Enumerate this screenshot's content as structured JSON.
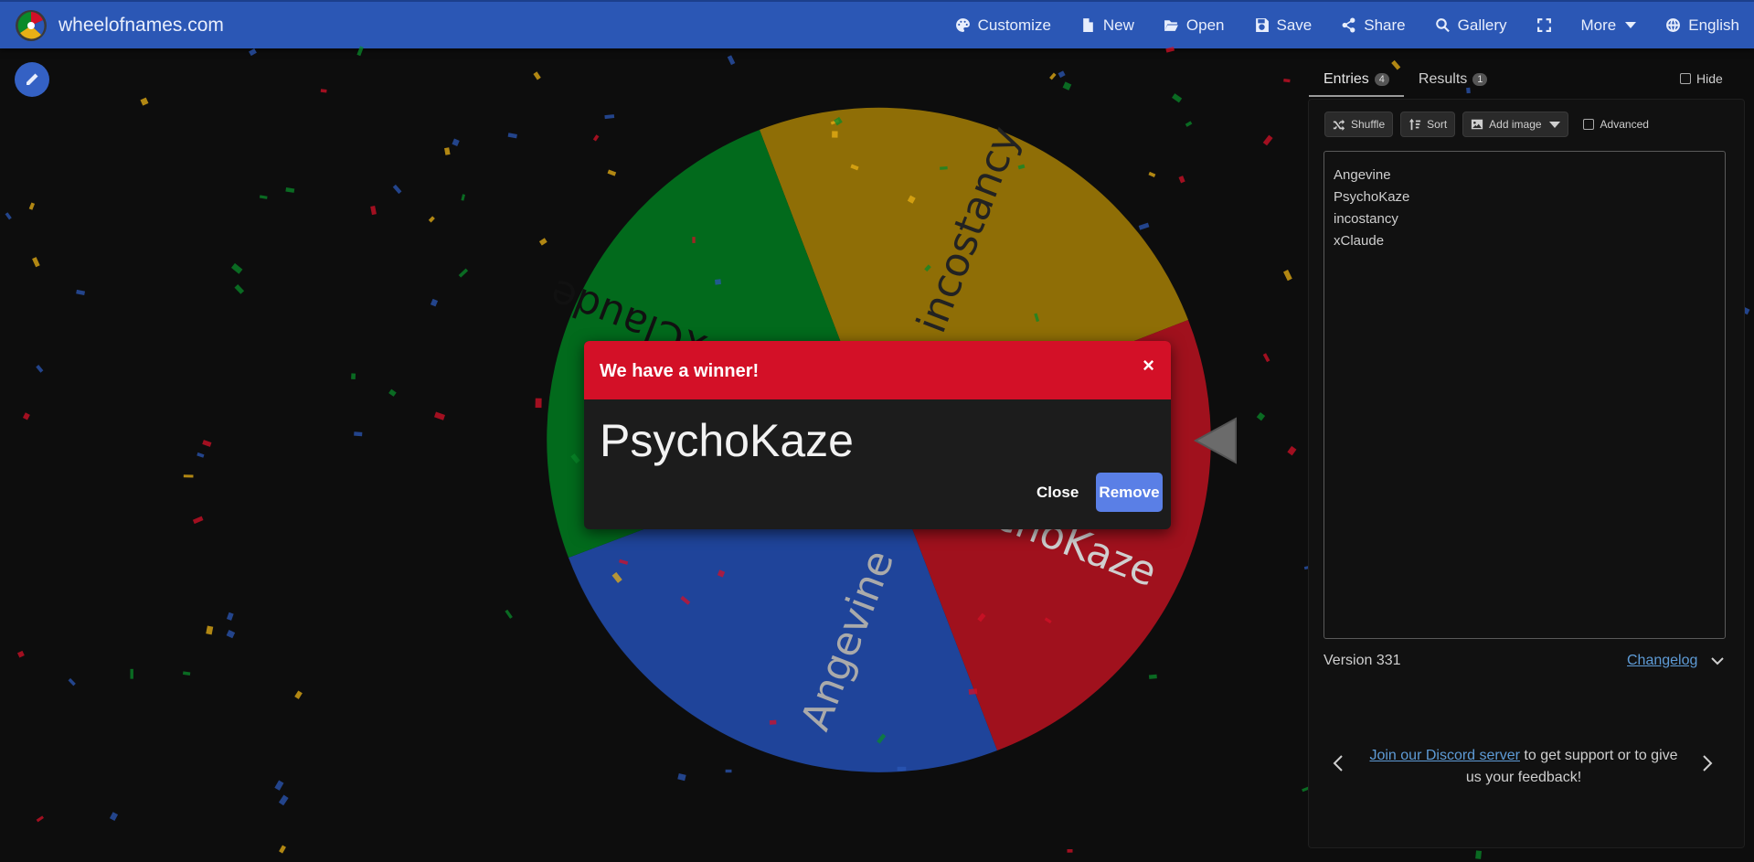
{
  "header": {
    "site_title": "wheelofnames.com",
    "menu": [
      {
        "label": "Customize",
        "icon": "palette-icon"
      },
      {
        "label": "New",
        "icon": "file-icon"
      },
      {
        "label": "Open",
        "icon": "folder-open-icon"
      },
      {
        "label": "Save",
        "icon": "save-icon"
      },
      {
        "label": "Share",
        "icon": "share-icon"
      },
      {
        "label": "Gallery",
        "icon": "search-icon"
      },
      {
        "label": "",
        "icon": "fullscreen-icon"
      },
      {
        "label": "More",
        "icon": "caret-down-icon"
      },
      {
        "label": "English",
        "icon": "globe-icon"
      }
    ]
  },
  "wheel": {
    "segments": [
      {
        "label": "incostancy",
        "color": "#8f6e06"
      },
      {
        "label": "PsychoKaze",
        "color": "#a0111d"
      },
      {
        "label": "Angevine",
        "color": "#1f449a"
      },
      {
        "label": "xClaude",
        "color": "#026a1c"
      }
    ]
  },
  "dialog": {
    "title": "We have a winner!",
    "close_x": "×",
    "winner": "PsychoKaze",
    "close_label": "Close",
    "remove_label": "Remove"
  },
  "sidebar": {
    "tabs": [
      {
        "label": "Entries",
        "count": "4"
      },
      {
        "label": "Results",
        "count": "1"
      }
    ],
    "hide_label": "Hide",
    "toolbar": {
      "shuffle": "Shuffle",
      "sort": "Sort",
      "add_image": "Add image",
      "advanced": "Advanced"
    },
    "entries": [
      "Angevine",
      "PsychoKaze",
      "incostancy",
      "xClaude"
    ],
    "version": "Version 331",
    "changelog": "Changelog",
    "discord_link": "Join our Discord server",
    "discord_rest": " to get support or to give us your feedback!"
  },
  "colors": {
    "header_bg": "#2b57b5",
    "dialog_header": "#d31027",
    "remove_button": "#5a7fe6",
    "link": "#5e9bd6"
  }
}
